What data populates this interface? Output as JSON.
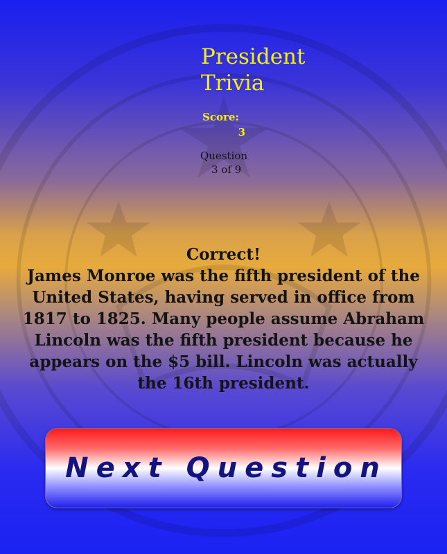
{
  "header": {
    "title": "President Trivia"
  },
  "score": {
    "label": "Score:",
    "value": "3"
  },
  "question": {
    "label": "Question",
    "progress": "3 of 9"
  },
  "feedback": {
    "status": "Correct!",
    "explanation": "James Monroe was the fifth president of the United States, having served in office from 1817 to 1825. Many people assume Abraham Lincoln was the fifth president because he appears on the $5 bill. Lincoln was actually the 16th president."
  },
  "actions": {
    "next_label": "Next Question"
  },
  "colors": {
    "title": "#f4f00a",
    "button_text": "#141480",
    "background_top": "#1a1ff0",
    "background_middle": "#e8aa3c"
  },
  "icons": {
    "watermark": "presidential-seal-icon"
  }
}
